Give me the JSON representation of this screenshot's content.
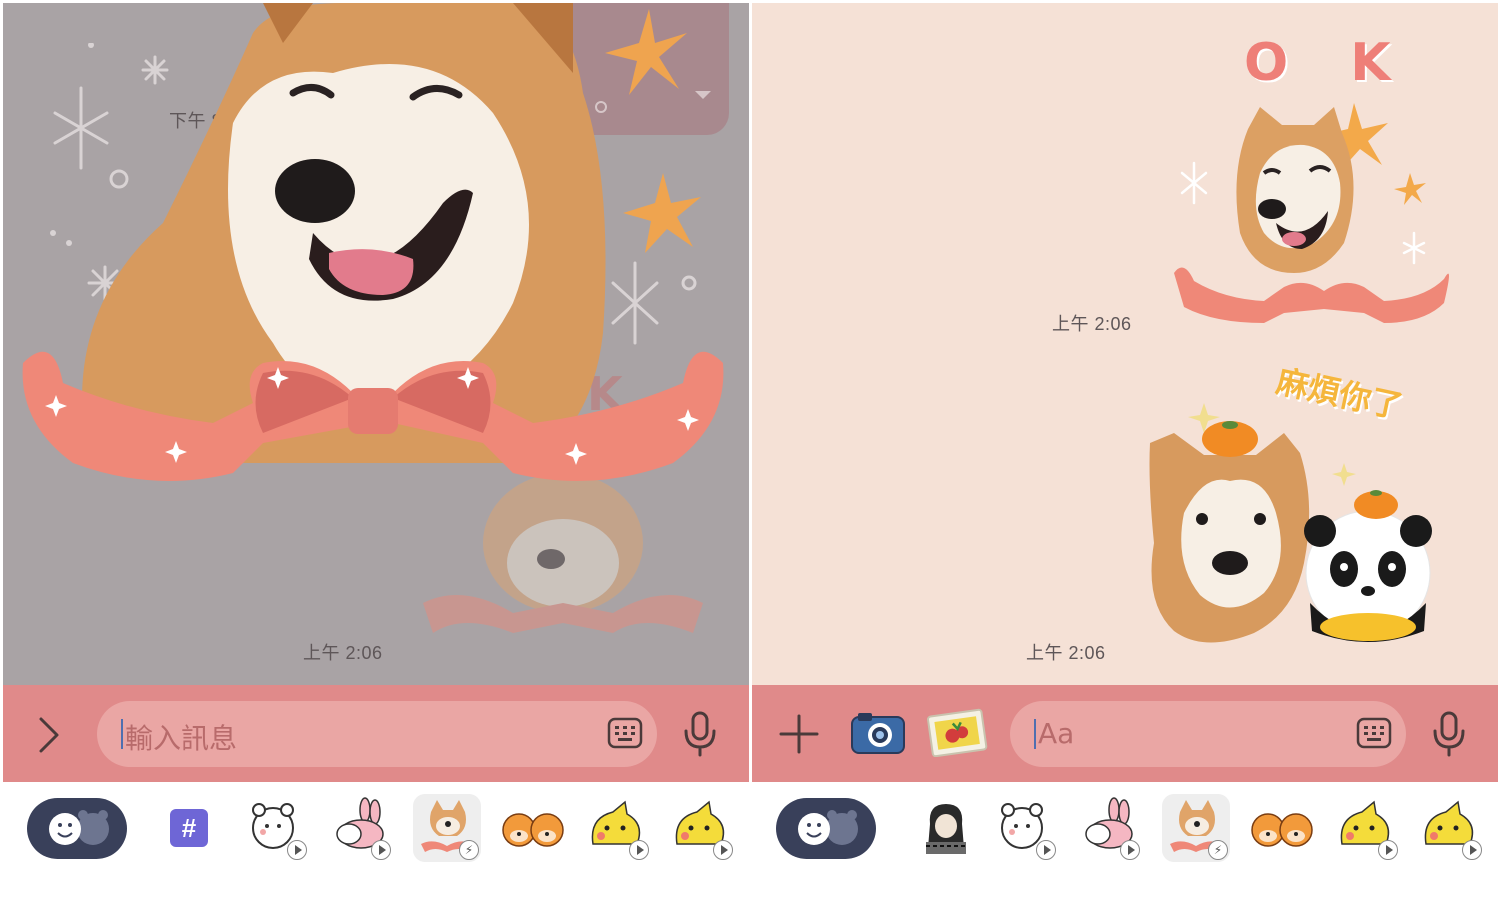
{
  "left_panel": {
    "chat": {
      "timestamp_partial": "下午 8",
      "timestamp": "上午 2:06",
      "faded_sticker_text": "K"
    },
    "input": {
      "expand_icon": "chevron-right-icon",
      "placeholder": "輸入訊息",
      "keyboard_icon": "keyboard-icon",
      "mic_icon": "microphone-icon"
    },
    "tray": {
      "items": [
        {
          "name": "emoji-toggle"
        },
        {
          "name": "hashtag-tab",
          "label": "#"
        },
        {
          "name": "bear-sticker-pack",
          "badge": "play"
        },
        {
          "name": "rabbit-sticker-pack",
          "badge": "play"
        },
        {
          "name": "shiba-sticker-pack",
          "badge": "bolt",
          "selected": true
        },
        {
          "name": "orange-shiba-sticker-pack"
        },
        {
          "name": "yellow-chick-sticker-pack-1",
          "badge": "play"
        },
        {
          "name": "yellow-chick-sticker-pack-2",
          "badge": "play"
        }
      ]
    }
  },
  "right_panel": {
    "chat": {
      "sticker1_text": "O K",
      "timestamp1": "上午 2:06",
      "sticker2_text": "麻煩你了",
      "timestamp2": "上午 2:06"
    },
    "input": {
      "plus_icon": "plus-icon",
      "camera_icon": "camera-icon",
      "image_icon": "image-icon",
      "placeholder": "Aa",
      "keyboard_icon": "keyboard-icon",
      "mic_icon": "microphone-icon"
    },
    "tray": {
      "items": [
        {
          "name": "emoji-toggle"
        },
        {
          "name": "anime-character-sticker-pack"
        },
        {
          "name": "bear-sticker-pack",
          "badge": "play"
        },
        {
          "name": "rabbit-sticker-pack",
          "badge": "play"
        },
        {
          "name": "shiba-sticker-pack",
          "badge": "bolt",
          "selected": true
        },
        {
          "name": "orange-shiba-sticker-pack"
        },
        {
          "name": "yellow-chick-sticker-pack-1",
          "badge": "play"
        },
        {
          "name": "yellow-chick-sticker-pack-2",
          "badge": "play"
        }
      ]
    }
  },
  "colors": {
    "left_chat_bg": "#a9a3a5",
    "right_chat_bg": "#f5e1d6",
    "input_bar": "#e08a8a",
    "input_field": "#eaa6a4",
    "ribbon": "#ef8878",
    "emoji_toggle": "#39405a",
    "hashtag_tab": "#6e66d6"
  }
}
